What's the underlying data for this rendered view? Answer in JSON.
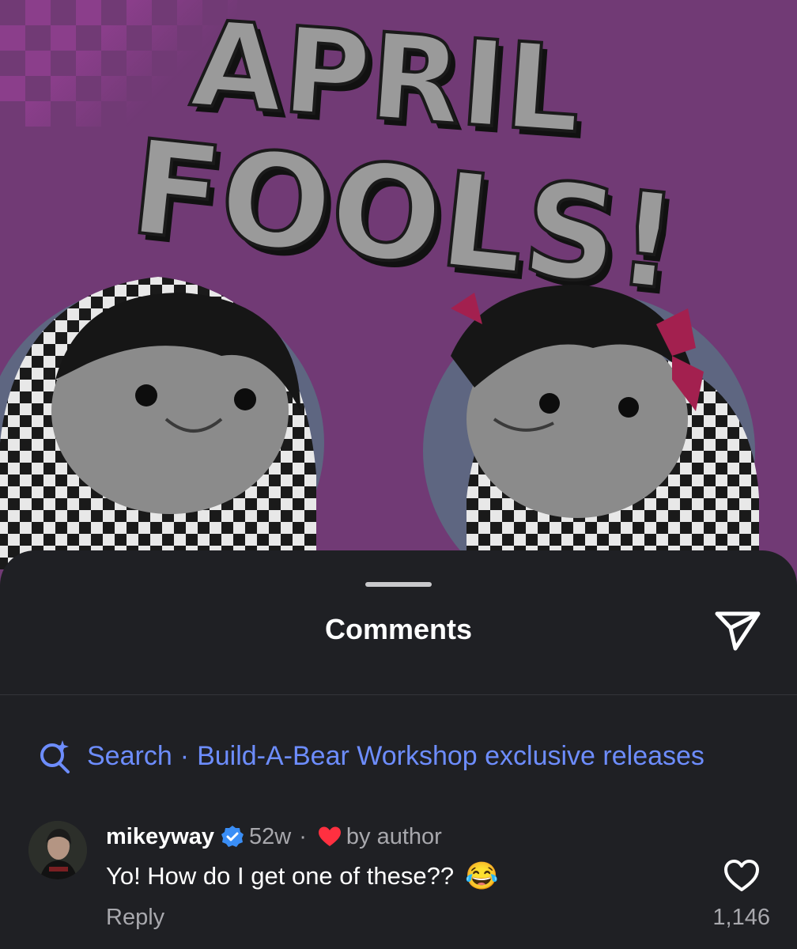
{
  "post": {
    "headline_line1": "APRIL",
    "headline_line2": "FOOLS!"
  },
  "sheet": {
    "title": "Comments",
    "search_label": "Search",
    "search_separator": "·",
    "search_query": "Build-A-Bear Workshop exclusive releases"
  },
  "comment": {
    "username": "mikeyway",
    "age": "52w",
    "dot": "·",
    "liked_label": "by author",
    "text": "Yo! How do I get one of these??",
    "emoji": "😂",
    "reply_label": "Reply",
    "like_count": "1,146"
  },
  "colors": {
    "post_background": "#713a75",
    "sheet_background": "#1f2024",
    "link_blue": "#6d8dff",
    "verified_blue": "#3a8ef6",
    "heart_red": "#ff3040"
  },
  "icons": [
    "share-send-icon",
    "search-sparkle-icon",
    "verified-badge-icon",
    "heart-filled-icon",
    "heart-outline-icon"
  ]
}
